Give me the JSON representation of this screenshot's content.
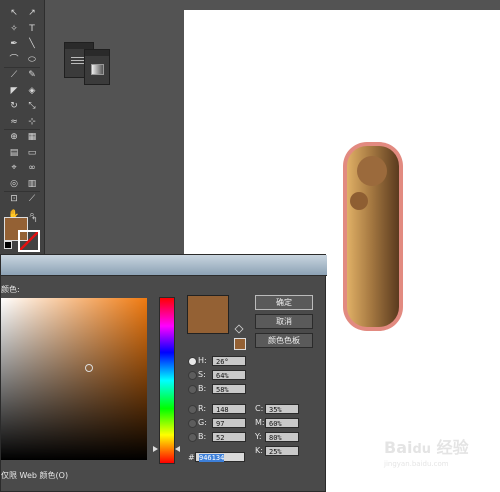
{
  "tools": {
    "rows": [
      [
        "arrow",
        "direct-select"
      ],
      [
        "magic-wand",
        "text"
      ],
      [
        "pen",
        "line"
      ],
      [
        "arc",
        "ellipse"
      ],
      [
        "brush",
        "pencil"
      ],
      [
        "blob-brush",
        "eraser"
      ],
      [
        "rotate",
        "scale"
      ],
      [
        "warp",
        "free-transform"
      ],
      [
        "shape-builder",
        "perspective"
      ],
      [
        "mesh",
        "gradient"
      ],
      [
        "eyedropper",
        "blend"
      ],
      [
        "symbol-sprayer",
        "graph"
      ],
      [
        "artboard",
        "slice"
      ],
      [
        "hand",
        "zoom"
      ]
    ],
    "glyphs": {
      "arrow": "↖",
      "direct-select": "↗",
      "magic-wand": "✧",
      "text": "T",
      "pen": "✒",
      "line": "╲",
      "arc": "⌒",
      "ellipse": "⬭",
      "brush": "⟋",
      "pencil": "✎",
      "blob-brush": "◤",
      "eraser": "◈",
      "rotate": "↻",
      "scale": "⤡",
      "warp": "≈",
      "free-transform": "⊹",
      "shape-builder": "⊕",
      "perspective": "▦",
      "mesh": "▤",
      "gradient": "▭",
      "eyedropper": "⌖",
      "blend": "∞",
      "symbol-sprayer": "◎",
      "graph": "▥",
      "artboard": "⊡",
      "slice": "⟋",
      "hand": "✋",
      "zoom": "⌕"
    },
    "fill_color": "#946134"
  },
  "dialog": {
    "section_label": "颜色:",
    "ok_label": "确定",
    "cancel_label": "取消",
    "swatches_label": "颜色色板",
    "hsb": [
      {
        "label": "H:",
        "value": "26°"
      },
      {
        "label": "S:",
        "value": "64%"
      },
      {
        "label": "B:",
        "value": "58%"
      }
    ],
    "rgb": [
      {
        "label": "R:",
        "value": "148"
      },
      {
        "label": "G:",
        "value": "97"
      },
      {
        "label": "B:",
        "value": "52"
      }
    ],
    "cmyk": [
      {
        "label": "C:",
        "value": "35%"
      },
      {
        "label": "M:",
        "value": "60%"
      },
      {
        "label": "Y:",
        "value": "80%"
      },
      {
        "label": "K:",
        "value": "25%"
      }
    ],
    "hex_prefix": "#",
    "hex_value": "946134",
    "web_label": "仅限 Web 颜色(O)",
    "selected_color": "#946134"
  },
  "watermark": {
    "text": "Baidu经验",
    "url": "jingyan.baidu.com"
  }
}
